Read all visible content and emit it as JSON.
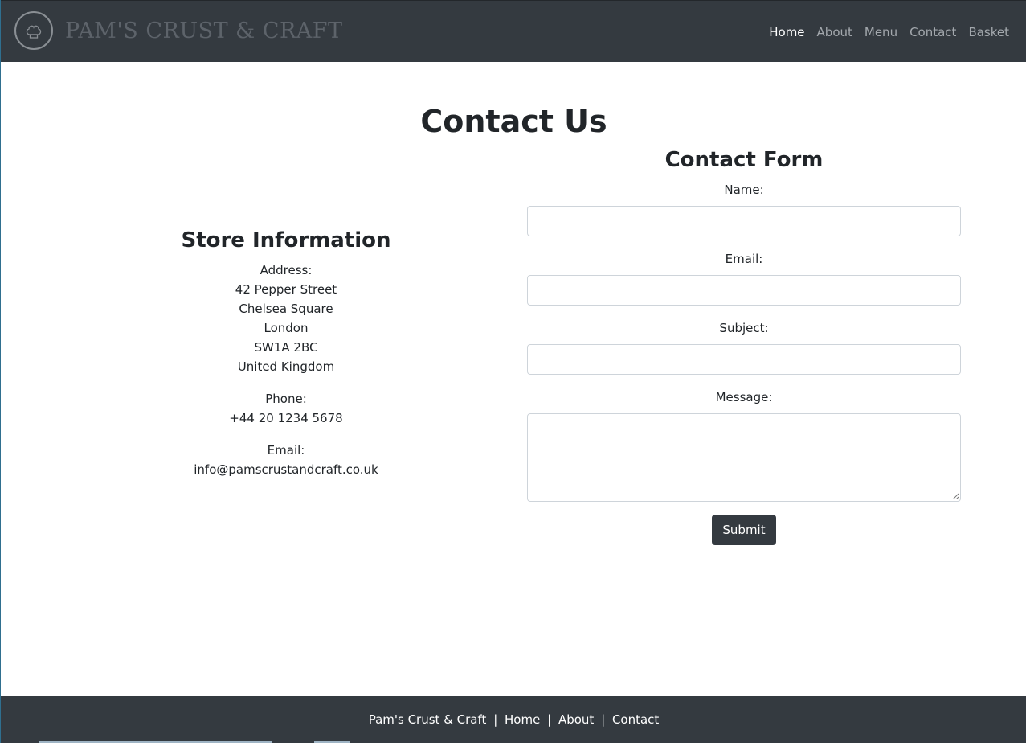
{
  "header": {
    "brand": "PAM'S CRUST & CRAFT",
    "logo_icon": "chef-hat-icon",
    "nav": [
      {
        "label": "Home",
        "active": true
      },
      {
        "label": "About",
        "active": false
      },
      {
        "label": "Menu",
        "active": false
      },
      {
        "label": "Contact",
        "active": false
      },
      {
        "label": "Basket",
        "active": false
      }
    ]
  },
  "page": {
    "title": "Contact Us"
  },
  "store": {
    "heading": "Store Information",
    "address_label": "Address:",
    "address_lines": [
      "42 Pepper Street",
      "Chelsea Square",
      "London",
      "SW1A 2BC",
      "United Kingdom"
    ],
    "phone_label": "Phone:",
    "phone": "+44 20 1234 5678",
    "email_label": "Email:",
    "email": "info@pamscrustandcraft.co.uk"
  },
  "form": {
    "heading": "Contact Form",
    "name_label": "Name:",
    "email_label": "Email:",
    "subject_label": "Subject:",
    "message_label": "Message:",
    "submit_label": "Submit"
  },
  "footer": {
    "brand": "Pam's Crust & Craft",
    "separator": "|",
    "links": [
      "Home",
      "About",
      "Contact"
    ]
  },
  "colors": {
    "navbar_bg": "#343a40",
    "nav_active": "#ffffff",
    "nav_inactive": "#a3a8ad",
    "button_bg": "#343a40"
  }
}
